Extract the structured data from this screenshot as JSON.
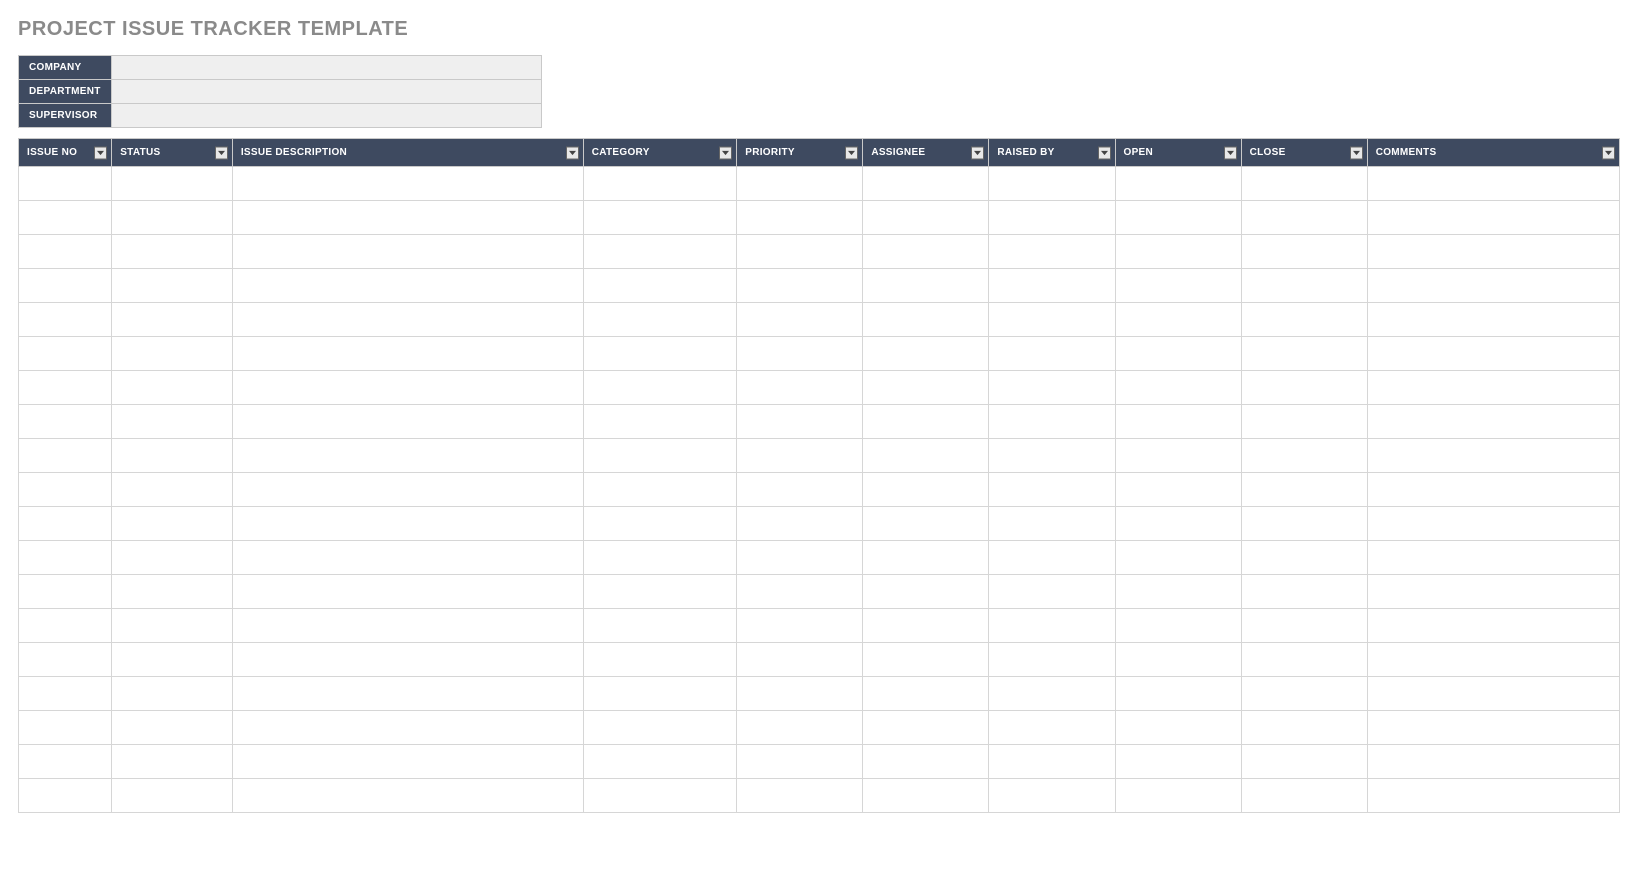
{
  "title": "PROJECT ISSUE TRACKER TEMPLATE",
  "meta": {
    "labels": {
      "company": "COMPANY",
      "department": "DEPARTMENT",
      "supervisor": "SUPERVISOR"
    },
    "values": {
      "company": "",
      "department": "",
      "supervisor": ""
    }
  },
  "columns": {
    "issue_no": "ISSUE NO",
    "status": "STATUS",
    "issue_description": "ISSUE DESCRIPTION",
    "category": "CATEGORY",
    "priority": "PRIORITY",
    "assignee": "ASSIGNEE",
    "raised_by": "RAISED BY",
    "open": "OPEN",
    "close": "CLOSE",
    "comments": "COMMENTS"
  },
  "rows": [
    {
      "issue_no": "",
      "status": "",
      "issue_description": "",
      "category": "",
      "priority": "",
      "assignee": "",
      "raised_by": "",
      "open": "",
      "close": "",
      "comments": ""
    },
    {
      "issue_no": "",
      "status": "",
      "issue_description": "",
      "category": "",
      "priority": "",
      "assignee": "",
      "raised_by": "",
      "open": "",
      "close": "",
      "comments": ""
    },
    {
      "issue_no": "",
      "status": "",
      "issue_description": "",
      "category": "",
      "priority": "",
      "assignee": "",
      "raised_by": "",
      "open": "",
      "close": "",
      "comments": ""
    },
    {
      "issue_no": "",
      "status": "",
      "issue_description": "",
      "category": "",
      "priority": "",
      "assignee": "",
      "raised_by": "",
      "open": "",
      "close": "",
      "comments": ""
    },
    {
      "issue_no": "",
      "status": "",
      "issue_description": "",
      "category": "",
      "priority": "",
      "assignee": "",
      "raised_by": "",
      "open": "",
      "close": "",
      "comments": ""
    },
    {
      "issue_no": "",
      "status": "",
      "issue_description": "",
      "category": "",
      "priority": "",
      "assignee": "",
      "raised_by": "",
      "open": "",
      "close": "",
      "comments": ""
    },
    {
      "issue_no": "",
      "status": "",
      "issue_description": "",
      "category": "",
      "priority": "",
      "assignee": "",
      "raised_by": "",
      "open": "",
      "close": "",
      "comments": ""
    },
    {
      "issue_no": "",
      "status": "",
      "issue_description": "",
      "category": "",
      "priority": "",
      "assignee": "",
      "raised_by": "",
      "open": "",
      "close": "",
      "comments": ""
    },
    {
      "issue_no": "",
      "status": "",
      "issue_description": "",
      "category": "",
      "priority": "",
      "assignee": "",
      "raised_by": "",
      "open": "",
      "close": "",
      "comments": ""
    },
    {
      "issue_no": "",
      "status": "",
      "issue_description": "",
      "category": "",
      "priority": "",
      "assignee": "",
      "raised_by": "",
      "open": "",
      "close": "",
      "comments": ""
    },
    {
      "issue_no": "",
      "status": "",
      "issue_description": "",
      "category": "",
      "priority": "",
      "assignee": "",
      "raised_by": "",
      "open": "",
      "close": "",
      "comments": ""
    },
    {
      "issue_no": "",
      "status": "",
      "issue_description": "",
      "category": "",
      "priority": "",
      "assignee": "",
      "raised_by": "",
      "open": "",
      "close": "",
      "comments": ""
    },
    {
      "issue_no": "",
      "status": "",
      "issue_description": "",
      "category": "",
      "priority": "",
      "assignee": "",
      "raised_by": "",
      "open": "",
      "close": "",
      "comments": ""
    },
    {
      "issue_no": "",
      "status": "",
      "issue_description": "",
      "category": "",
      "priority": "",
      "assignee": "",
      "raised_by": "",
      "open": "",
      "close": "",
      "comments": ""
    },
    {
      "issue_no": "",
      "status": "",
      "issue_description": "",
      "category": "",
      "priority": "",
      "assignee": "",
      "raised_by": "",
      "open": "",
      "close": "",
      "comments": ""
    },
    {
      "issue_no": "",
      "status": "",
      "issue_description": "",
      "category": "",
      "priority": "",
      "assignee": "",
      "raised_by": "",
      "open": "",
      "close": "",
      "comments": ""
    },
    {
      "issue_no": "",
      "status": "",
      "issue_description": "",
      "category": "",
      "priority": "",
      "assignee": "",
      "raised_by": "",
      "open": "",
      "close": "",
      "comments": ""
    },
    {
      "issue_no": "",
      "status": "",
      "issue_description": "",
      "category": "",
      "priority": "",
      "assignee": "",
      "raised_by": "",
      "open": "",
      "close": "",
      "comments": ""
    },
    {
      "issue_no": "",
      "status": "",
      "issue_description": "",
      "category": "",
      "priority": "",
      "assignee": "",
      "raised_by": "",
      "open": "",
      "close": "",
      "comments": ""
    }
  ]
}
